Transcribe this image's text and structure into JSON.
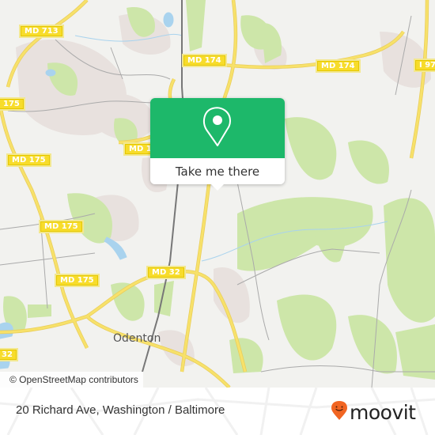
{
  "map": {
    "road_labels": [
      {
        "id": "md713",
        "text": "MD 713"
      },
      {
        "id": "md174a",
        "text": "MD 174"
      },
      {
        "id": "md174b",
        "text": "MD 174"
      },
      {
        "id": "i97",
        "text": "I 97"
      },
      {
        "id": "md175a",
        "text": "175"
      },
      {
        "id": "md175b",
        "text": "MD 175"
      },
      {
        "id": "md17x",
        "text": "MD 1"
      },
      {
        "id": "md175c",
        "text": "MD 175"
      },
      {
        "id": "md175d",
        "text": "MD 175"
      },
      {
        "id": "md32a",
        "text": "MD 32"
      },
      {
        "id": "md32b",
        "text": "32"
      }
    ],
    "places": [
      {
        "id": "odenton",
        "text": "Odenton"
      }
    ],
    "attribution": "© OpenStreetMap contributors",
    "colors": {
      "background": "#f2f2ef",
      "park": "#cde6a9",
      "urban": "#e8e1de",
      "water": "#a9d3ee",
      "road_major": "#f7e16a",
      "road_minor": "#aaaaaa",
      "rail": "#777777"
    }
  },
  "popup": {
    "button_label": "Take me there",
    "icon": "map-pin-icon",
    "color": "#1db86a"
  },
  "footer": {
    "address": "20 Richard Ave, Washington / Baltimore",
    "brand": "moovit",
    "brand_icon": "moovit-smile-pin-icon",
    "brand_color": "#f16522"
  }
}
